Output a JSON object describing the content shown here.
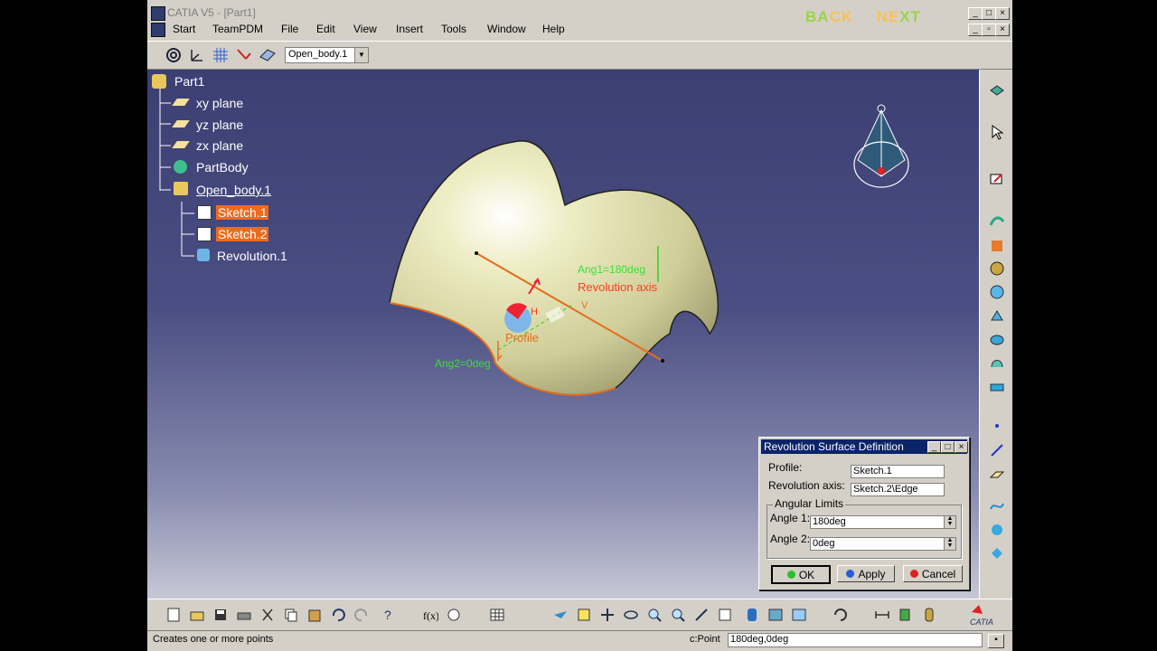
{
  "window": {
    "title": "CATIA V5 - [Part1]",
    "back_label_1": "BA",
    "back_label_2": "CK",
    "next_label_1": "NE",
    "next_label_2": "XT"
  },
  "menu": [
    "Start",
    "TeamPDM",
    "File",
    "Edit",
    "View",
    "Insert",
    "Tools",
    "Window",
    "Help"
  ],
  "toolbar": {
    "workbench_combo": "Open_body.1"
  },
  "tree": {
    "root": "Part1",
    "planes": [
      "xy plane",
      "yz plane",
      "zx plane"
    ],
    "body": "PartBody",
    "open_body": "Open_body.1",
    "children": [
      "Sketch.1",
      "Sketch.2",
      "Revolution.1"
    ]
  },
  "annotations": {
    "ang1": "Ang1=180deg",
    "revolution_axis": "Revolution axis",
    "profile": "Profile",
    "ang2": "Ang2=0deg",
    "h": "H",
    "v": "V"
  },
  "dialog": {
    "title": "Revolution Surface Definition",
    "profile_label": "Profile:",
    "profile_value": "Sketch.1",
    "axis_label": "Revolution axis:",
    "axis_value": "Sketch.2\\Edge",
    "group_label": "Angular Limits",
    "angle1_label": "Angle 1:",
    "angle1_value": "180deg",
    "angle2_label": "Angle 2:",
    "angle2_value": "0deg",
    "ok": "OK",
    "apply": "Apply",
    "cancel": "Cancel"
  },
  "status": {
    "message": "Creates one or more points",
    "command_label": "c:Point",
    "command_value": "180deg,0deg"
  },
  "colors": {
    "viewport_top": "#3b3f72",
    "highlight": "#f06a1c",
    "surface": "#e7e6b8"
  }
}
